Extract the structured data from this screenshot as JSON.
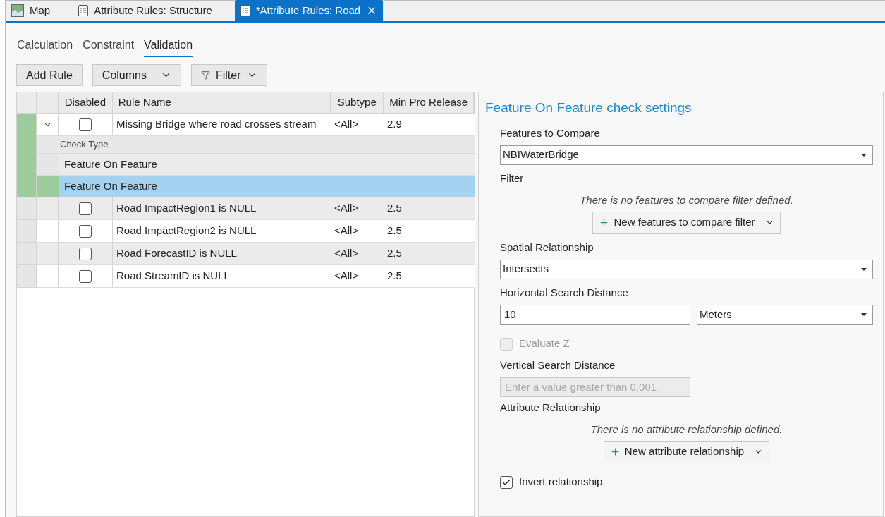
{
  "tabs": [
    {
      "label": "Map",
      "kind": "map",
      "selected": false
    },
    {
      "label": "Attribute Rules: Structure",
      "kind": "rules",
      "selected": false
    },
    {
      "label": "*Attribute Rules: Road",
      "kind": "rules",
      "selected": true
    }
  ],
  "subtabs": [
    {
      "label": "Calculation",
      "selected": false
    },
    {
      "label": "Constraint",
      "selected": false
    },
    {
      "label": "Validation",
      "selected": true
    }
  ],
  "toolbar": [
    {
      "label": "Add Rule",
      "kind": "plain"
    },
    {
      "label": "Columns",
      "kind": "dropdown"
    },
    {
      "label": "Filter",
      "kind": "filter"
    }
  ],
  "table": {
    "columns": [
      "Disabled",
      "Rule Name",
      "Subtype",
      "Min Pro Release"
    ],
    "rows": [
      {
        "selected": true,
        "expanded": true,
        "disabled": false,
        "name": "Missing Bridge where road crosses stream",
        "subtype": "<All>",
        "min_release": "2.9",
        "details": {
          "heading": "Check Type",
          "items": [
            {
              "label": "Feature On Feature",
              "selected": false
            },
            {
              "label": "Feature On Feature",
              "selected": true
            }
          ]
        }
      },
      {
        "selected": false,
        "disabled": false,
        "name": "Road ImpactRegion1 is NULL",
        "subtype": "<All>",
        "min_release": "2.5"
      },
      {
        "selected": false,
        "disabled": false,
        "name": "Road ImpactRegion2 is NULL",
        "subtype": "<All>",
        "min_release": "2.5"
      },
      {
        "selected": false,
        "disabled": false,
        "name": "Road ForecastID is NULL",
        "subtype": "<All>",
        "min_release": "2.5"
      },
      {
        "selected": false,
        "disabled": false,
        "name": "Road StreamID is NULL",
        "subtype": "<All>",
        "min_release": "2.5"
      }
    ]
  },
  "settings": {
    "title": "Feature On Feature check settings",
    "items": [
      {
        "kind": "label",
        "text": "Features to Compare"
      },
      {
        "kind": "dropdown",
        "value": "NBIWaterBridge"
      },
      {
        "kind": "label",
        "text": "Filter"
      },
      {
        "kind": "note",
        "text": "There is no features to compare filter defined."
      },
      {
        "kind": "add-button",
        "label": "New features to compare filter"
      },
      {
        "kind": "label",
        "text": "Spatial Relationship"
      },
      {
        "kind": "dropdown",
        "value": "Intersects"
      },
      {
        "kind": "label",
        "text": "Horizontal Search Distance"
      },
      {
        "kind": "distance",
        "value": "10",
        "unit": "Meters"
      },
      {
        "kind": "checkbox",
        "label": "Evaluate Z",
        "checked": false,
        "disabled": true
      },
      {
        "kind": "label",
        "text": "Vertical Search Distance"
      },
      {
        "kind": "input",
        "placeholder": "Enter a value greater than 0.001",
        "disabled": true
      },
      {
        "kind": "label",
        "text": "Attribute Relationship"
      },
      {
        "kind": "note",
        "text": "There is no attribute relationship defined."
      },
      {
        "kind": "add-button",
        "label": "New attribute relationship"
      },
      {
        "kind": "checkbox",
        "label": "Invert relationship",
        "checked": true,
        "disabled": false
      }
    ]
  }
}
